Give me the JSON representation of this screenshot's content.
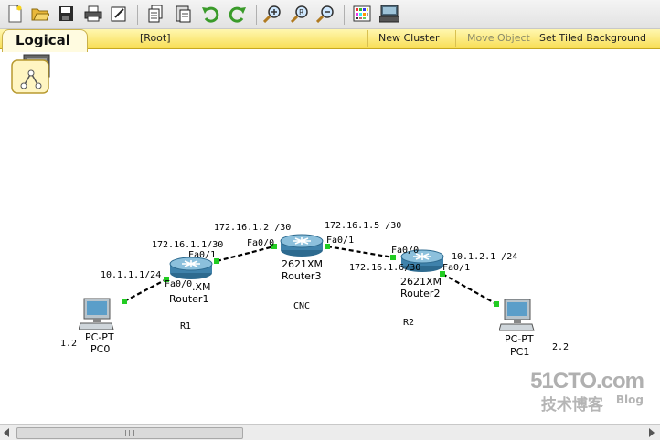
{
  "toolbar": {
    "buttons": [
      "new-icon",
      "open-icon",
      "save-icon",
      "print-icon",
      "activity-wizard-icon",
      "copy-icon",
      "paste-icon",
      "undo-icon",
      "redo-icon",
      "zoom-in-icon",
      "zoom-reset-icon",
      "zoom-out-icon",
      "palette-icon",
      "custom-device-icon"
    ]
  },
  "nav": {
    "tab": "Logical",
    "root": "[Root]",
    "new_cluster": "New Cluster",
    "move_object": "Move Object",
    "set_tiled_background": "Set Tiled Background"
  },
  "devices": {
    "router1": {
      "model": ".XM",
      "name": "Router1"
    },
    "router3": {
      "model": "2621XM",
      "name": "Router3"
    },
    "router2": {
      "model": "2621XM",
      "name": "Router2"
    },
    "pc0": {
      "model": "PC-PT",
      "name": "PC0"
    },
    "pc1": {
      "model": "PC-PT",
      "name": "PC1"
    }
  },
  "labels": {
    "ip_pc0_side": "10.1.1.1/24",
    "ip_r1_r3": "172.16.1.1/30",
    "ip_r3_r1": "172.16.1.2 /30",
    "ip_r3_r2": "172.16.1.5 /30",
    "ip_r2_r3": "172.16.1.6/30",
    "ip_pc1_side": "10.1.2.1 /24",
    "port_r1_fa00": "Fa0/0",
    "port_r1_fa01": "Fa0/1",
    "port_r3_fa00": "Fa0/0",
    "port_r3_fa01": "Fa0/1",
    "port_r2_fa00": "Fa0/0",
    "port_r2_fa01": "Fa0/1",
    "note_r1": "R1",
    "note_cnc": "CNC",
    "note_r2": "R2",
    "note_pc0": "1.2",
    "note_pc1": "2.2"
  },
  "watermark": {
    "site": "51CTO.com",
    "sub": "技术博客",
    "blog": "Blog"
  },
  "colors": {
    "nav_bg": "#f8de55",
    "link_green": "#22cc22",
    "router_blue": "#4a8ab0"
  }
}
